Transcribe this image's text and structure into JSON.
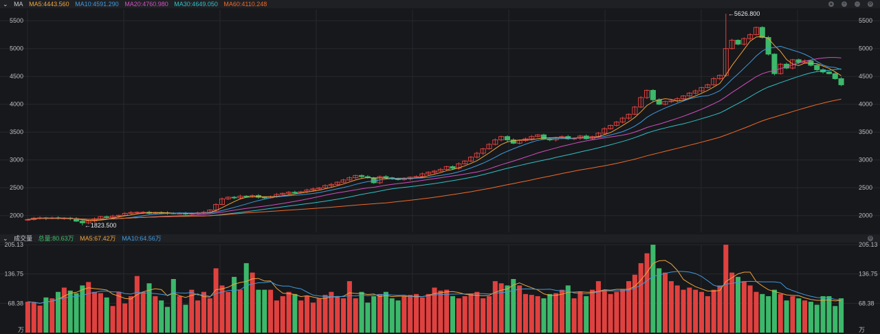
{
  "top_bar": {
    "label": "MA",
    "ma5": {
      "text": "MA5:4443.560",
      "color": "#f0a53a"
    },
    "ma10": {
      "text": "MA10:4591.290",
      "color": "#3f9be0"
    },
    "ma20": {
      "text": "MA20:4760.980",
      "color": "#d24fc2"
    },
    "ma30": {
      "text": "MA30:4649.050",
      "color": "#2fc1c8"
    },
    "ma60": {
      "text": "MA60:4110.248",
      "color": "#f06a2a"
    },
    "icons": [
      "collapse-icon",
      "up-icon",
      "down-icon",
      "settings-icon"
    ]
  },
  "vol_bar": {
    "label": "成交量",
    "total": {
      "text": "总量:80.63万",
      "color": "#3fbf6a"
    },
    "ma5": {
      "text": "MA5:67.42万",
      "color": "#f0a53a"
    },
    "ma10": {
      "text": "MA10:64.56万",
      "color": "#3f9be0"
    }
  },
  "colors": {
    "up": "#e0413f",
    "down": "#3cb86a",
    "grid": "#26282d",
    "text": "#b9bcc2",
    "bg": "#17181b"
  },
  "chart_data": [
    {
      "type": "candlestick",
      "title": "MA",
      "ylim": [
        1700,
        5700
      ],
      "yticks": [
        2000,
        2500,
        3000,
        3500,
        4000,
        4500,
        5000,
        5500
      ],
      "annotations": [
        {
          "text": "5626.800",
          "kind": "high"
        },
        {
          "text": "1823.500",
          "kind": "low"
        }
      ],
      "closes": [
        1930,
        1955,
        1960,
        1950,
        1960,
        1950,
        1955,
        1945,
        1900,
        1870,
        1905,
        1940,
        1980,
        1965,
        1990,
        2005,
        2040,
        2055,
        2060,
        2060,
        2040,
        2055,
        2050,
        2045,
        2040,
        2040,
        2030,
        2040,
        2050,
        2060,
        2100,
        2200,
        2300,
        2330,
        2320,
        2350,
        2340,
        2360,
        2330,
        2320,
        2340,
        2380,
        2400,
        2420,
        2410,
        2430,
        2460,
        2480,
        2500,
        2540,
        2560,
        2600,
        2640,
        2680,
        2720,
        2700,
        2680,
        2590,
        2700,
        2680,
        2660,
        2650,
        2660,
        2690,
        2700,
        2750,
        2780,
        2800,
        2830,
        2880,
        2850,
        2930,
        2980,
        3050,
        3120,
        3200,
        3280,
        3360,
        3420,
        3360,
        3300,
        3350,
        3380,
        3420,
        3450,
        3380,
        3360,
        3400,
        3420,
        3380,
        3390,
        3430,
        3380,
        3420,
        3480,
        3560,
        3620,
        3680,
        3750,
        3820,
        3950,
        4120,
        4250,
        4080,
        4000,
        4050,
        4060,
        4100,
        4150,
        4200,
        4240,
        4300,
        4350,
        4460,
        4520,
        5000,
        5150,
        5080,
        5180,
        5250,
        5380,
        5200,
        4900,
        4550,
        4720,
        4650,
        4800,
        4750,
        4780,
        4700,
        4620,
        4580,
        4550,
        4460,
        4350
      ],
      "high": {
        "index": 115,
        "value": 5626.8
      },
      "low": {
        "index": 9,
        "value": 1823.5
      },
      "ma_periods": [
        5,
        10,
        20,
        30,
        60
      ],
      "series": [
        {
          "name": "MA5",
          "value": 4443.56
        },
        {
          "name": "MA10",
          "value": 4591.29
        },
        {
          "name": "MA20",
          "value": 4760.98
        },
        {
          "name": "MA30",
          "value": 4649.05
        },
        {
          "name": "MA60",
          "value": 4110.248
        }
      ]
    },
    {
      "type": "bar",
      "title": "成交量",
      "unit": "万",
      "ylim": [
        0,
        205.13
      ],
      "yticks": [
        "205.13",
        "136.75",
        "68.38"
      ],
      "values": [
        72,
        70,
        63,
        82,
        80,
        95,
        105,
        98,
        92,
        110,
        118,
        95,
        92,
        82,
        62,
        95,
        68,
        85,
        132,
        95,
        115,
        85,
        75,
        60,
        125,
        85,
        65,
        100,
        75,
        95,
        80,
        150,
        110,
        95,
        130,
        100,
        162,
        140,
        100,
        100,
        100,
        75,
        85,
        95,
        90,
        75,
        85,
        70,
        80,
        88,
        95,
        82,
        80,
        120,
        80,
        95,
        70,
        85,
        90,
        95,
        80,
        75,
        85,
        88,
        90,
        82,
        90,
        105,
        98,
        100,
        85,
        80,
        85,
        90,
        95,
        80,
        85,
        120,
        115,
        110,
        125,
        110,
        90,
        88,
        85,
        80,
        90,
        92,
        100,
        110,
        80,
        95,
        85,
        100,
        120,
        100,
        90,
        95,
        100,
        120,
        135,
        162,
        185,
        205,
        150,
        140,
        120,
        110,
        100,
        105,
        100,
        95,
        85,
        100,
        110,
        205,
        140,
        130,
        120,
        110,
        95,
        90,
        85,
        100,
        90,
        75,
        85,
        80,
        75,
        72,
        65,
        85,
        85,
        62,
        80
      ],
      "series": [
        {
          "name": "总量",
          "value": 80.63
        },
        {
          "name": "MA5",
          "value": 67.42
        },
        {
          "name": "MA10",
          "value": 64.56
        }
      ]
    }
  ]
}
